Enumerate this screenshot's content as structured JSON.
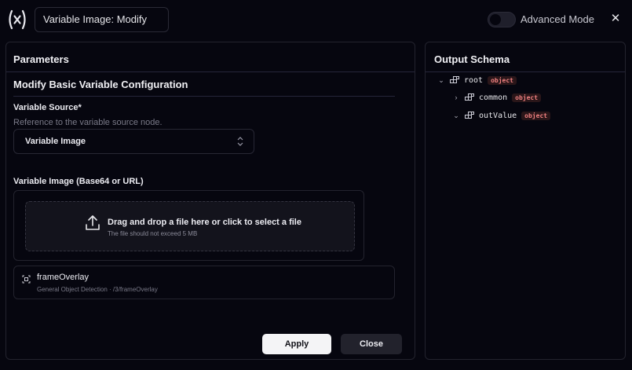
{
  "header": {
    "title_input_value": "Variable Image: Modify",
    "advanced_mode_label": "Advanced Mode",
    "advanced_mode_on": false,
    "close_glyph": "✕"
  },
  "parameters": {
    "title": "Parameters",
    "section_title": "Modify Basic Variable Configuration",
    "variable_source": {
      "label": "Variable Source*",
      "help": "Reference to the variable source node.",
      "selected": "Variable Image",
      "chevron_glyph": "⌃⌄"
    },
    "variable_image": {
      "label": "Variable Image (Base64 or URL)",
      "drop_main": "Drag and drop a file here or click to select a file",
      "drop_sub": "The file should not exceed 5 MB"
    },
    "item": {
      "title": "frameOverlay",
      "subtitle": "General Object Detection · /3/frameOverlay"
    },
    "apply_label": "Apply",
    "close_label": "Close"
  },
  "output_schema": {
    "title": "Output Schema",
    "nodes": [
      {
        "name": "root",
        "type": "object",
        "chevron": "⌄",
        "expanded": true
      },
      {
        "name": "common",
        "type": "object",
        "chevron": "›",
        "expanded": false
      },
      {
        "name": "outValue",
        "type": "object",
        "chevron": "⌄",
        "expanded": true
      }
    ]
  },
  "colors": {
    "background": "#06060f",
    "panel_border": "#23232e",
    "badge_text": "#f08080",
    "apply_button": "#f4f4f6"
  },
  "icons": [
    "variable-logo-icon",
    "close-icon",
    "chevron-updown-icon",
    "upload-icon",
    "frame-icon",
    "chevron-down-icon",
    "chevron-right-icon",
    "object-node-icon"
  ]
}
